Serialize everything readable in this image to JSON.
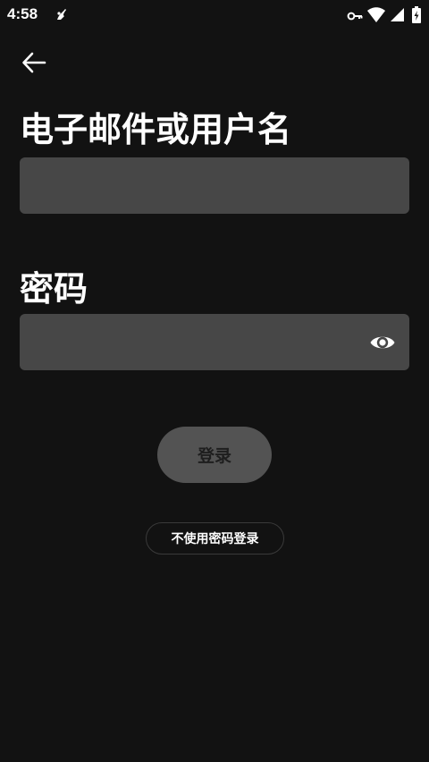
{
  "status_bar": {
    "time": "4:58",
    "icons": [
      "app-notification-icon",
      "vpn-key-icon",
      "wifi-icon",
      "signal-icon",
      "battery-charging-icon"
    ]
  },
  "header": {
    "back_icon": "arrow-left-icon"
  },
  "form": {
    "email": {
      "label": "电子邮件或用户名",
      "value": "",
      "placeholder": ""
    },
    "password": {
      "label": "密码",
      "value": "",
      "placeholder": "",
      "toggle_icon": "eye-icon"
    },
    "login_label": "登录",
    "no_password_label": "不使用密码登录"
  },
  "colors": {
    "background": "#121212",
    "field": "#474747",
    "button_disabled": "#535353",
    "text": "#ffffff"
  }
}
